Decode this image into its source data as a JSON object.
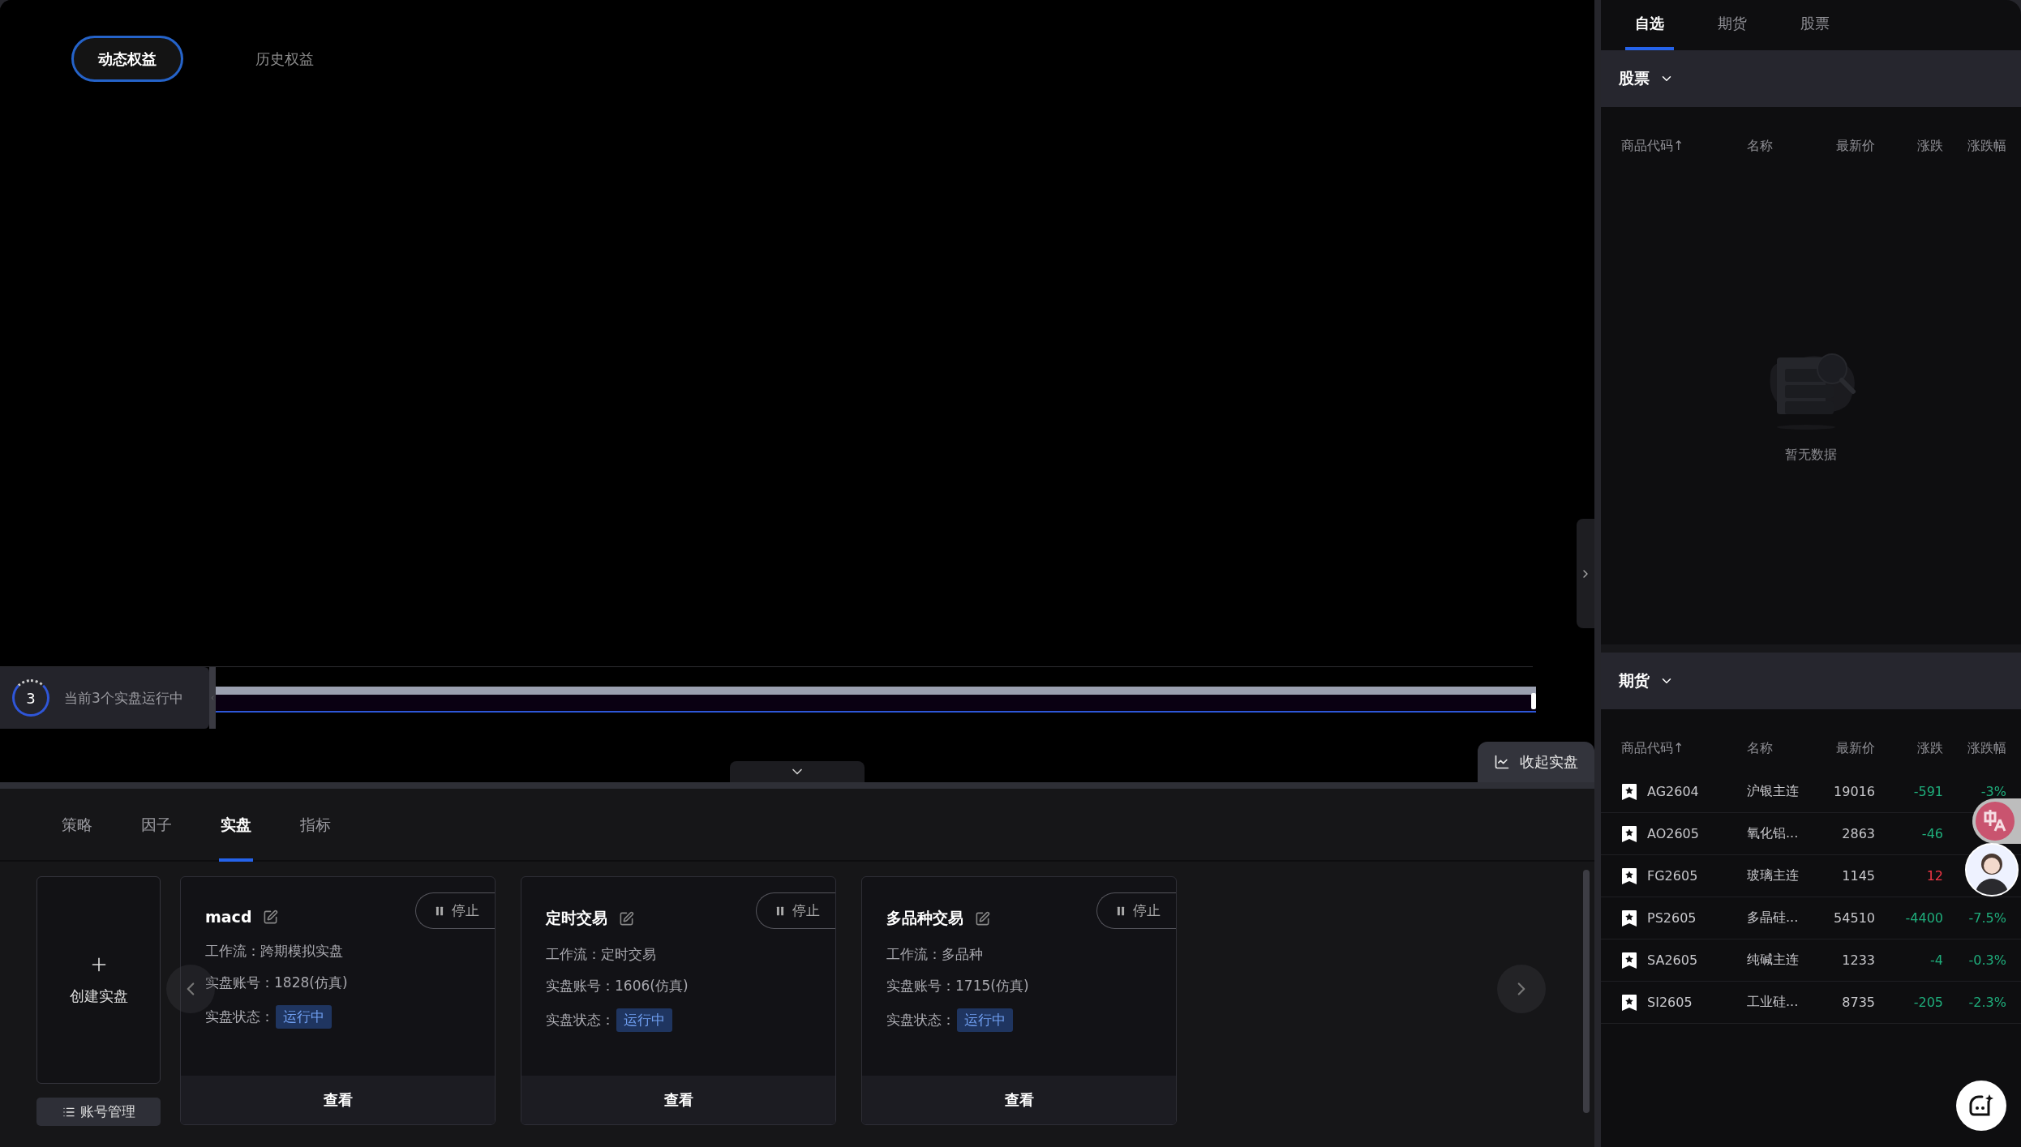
{
  "equity_tabs": [
    {
      "label": "动态权益",
      "selected": true
    },
    {
      "label": "历史权益",
      "selected": false
    }
  ],
  "running_counter": {
    "count": "3",
    "text": "当前3个实盘运行中"
  },
  "timeline": {
    "level": 1
  },
  "collapse_button": "收起实盘",
  "bottom_tabs": [
    {
      "label": "策略",
      "selected": false
    },
    {
      "label": "因子",
      "selected": false
    },
    {
      "label": "实盘",
      "selected": true
    },
    {
      "label": "指标",
      "selected": false
    }
  ],
  "create_card": {
    "label": "创建实盘"
  },
  "account_button": "账号管理",
  "strategies": [
    {
      "name": "macd",
      "stop": "停止",
      "workflow_label": "工作流：",
      "workflow": "跨期模拟实盘",
      "account_label": "实盘账号：",
      "account": "1828(仿真)",
      "status_label": "实盘状态：",
      "status": "运行中",
      "running": true,
      "view": "查看"
    },
    {
      "name": "定时交易",
      "stop": "停止",
      "workflow_label": "工作流：",
      "workflow": "定时交易",
      "account_label": "实盘账号：",
      "account": "1606(仿真)",
      "status_label": "实盘状态：",
      "status": "运行中",
      "running": true,
      "view": "查看"
    },
    {
      "name": "多品种交易",
      "stop": "停止",
      "workflow_label": "工作流：",
      "workflow": "多品种",
      "account_label": "实盘账号：",
      "account": "1715(仿真)",
      "status_label": "实盘状态：",
      "status": "运行中",
      "running": true,
      "view": "查看"
    }
  ],
  "watch_tabs": [
    {
      "label": "自选",
      "selected": true
    },
    {
      "label": "期货",
      "selected": false
    },
    {
      "label": "股票",
      "selected": false
    }
  ],
  "sections": [
    {
      "title": "股票",
      "columns": [
        "商品代码↑",
        "名称",
        "最新价",
        "涨跌",
        "涨跌幅"
      ],
      "empty_text": "暂无数据"
    },
    {
      "title": "期货",
      "columns": [
        "商品代码↑",
        "名称",
        "最新价",
        "涨跌",
        "涨跌幅"
      ],
      "rows": [
        {
          "code": "AG2604",
          "name": "沪银主连",
          "price": "19016",
          "change": "-591",
          "pct": "-3%",
          "color": "#1fae7c"
        },
        {
          "code": "AO2605",
          "name": "氧化铝...",
          "price": "2863",
          "change": "-46",
          "color": "#1fae7c"
        },
        {
          "code": "FG2605",
          "name": "玻璃主连",
          "price": "1145",
          "change": "12",
          "color": "#f23645"
        },
        {
          "code": "PS2605",
          "name": "多晶硅...",
          "price": "54510",
          "change": "-4400",
          "pct": "-7.5%",
          "color": "#1fae7c"
        },
        {
          "code": "SA2605",
          "name": "纯碱主连",
          "price": "1233",
          "change": "-4",
          "pct": "-0.3%",
          "color": "#1fae7c"
        },
        {
          "code": "SI2605",
          "name": "工业硅...",
          "price": "8735",
          "change": "-205",
          "pct": "-2.3%",
          "color": "#1fae7c"
        }
      ]
    }
  ]
}
